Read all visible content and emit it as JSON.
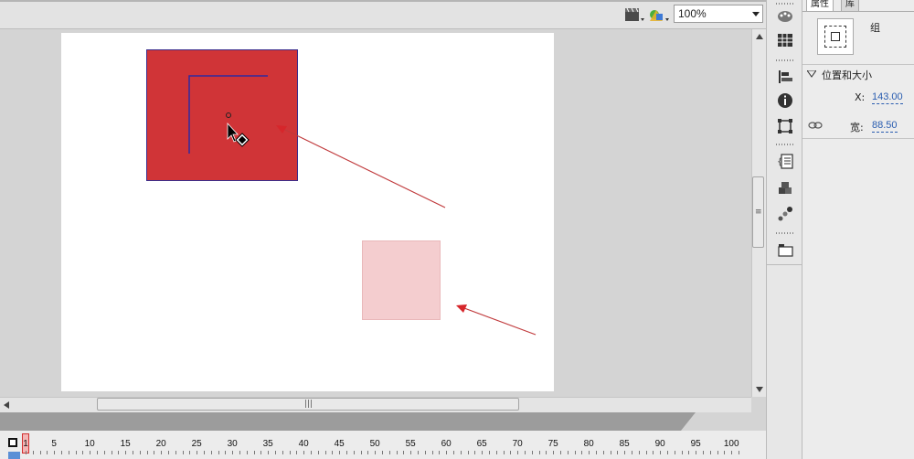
{
  "toolbar": {
    "zoom_value": "100%",
    "icons": [
      "edit-scene-icon",
      "edit-symbol-icon"
    ]
  },
  "stage": {
    "background": "#ffffff",
    "group_fill": "#d03437",
    "group_stroke": "#3a2d8c",
    "copy_fill": "#f4cdcf",
    "arrow_color": "#c0393b"
  },
  "timeline": {
    "frame_numbers": [
      "1",
      "5",
      "10",
      "15",
      "20",
      "25",
      "30",
      "35",
      "40",
      "45",
      "50",
      "55",
      "60",
      "65",
      "70",
      "75",
      "80",
      "85",
      "90",
      "95",
      "100"
    ]
  },
  "tools": [
    "color-palette-icon",
    "swatches-icon",
    "align-icon",
    "info-icon",
    "transform-icon",
    "actions-icon",
    "components-icon",
    "motion-presets-icon",
    "library-icon"
  ],
  "properties": {
    "tabs": [
      "属性",
      "库"
    ],
    "object_type": "组",
    "section_title": "位置和大小",
    "x_label": "X:",
    "x_value": "143.00",
    "width_label": "宽:",
    "width_value": "88.50"
  }
}
